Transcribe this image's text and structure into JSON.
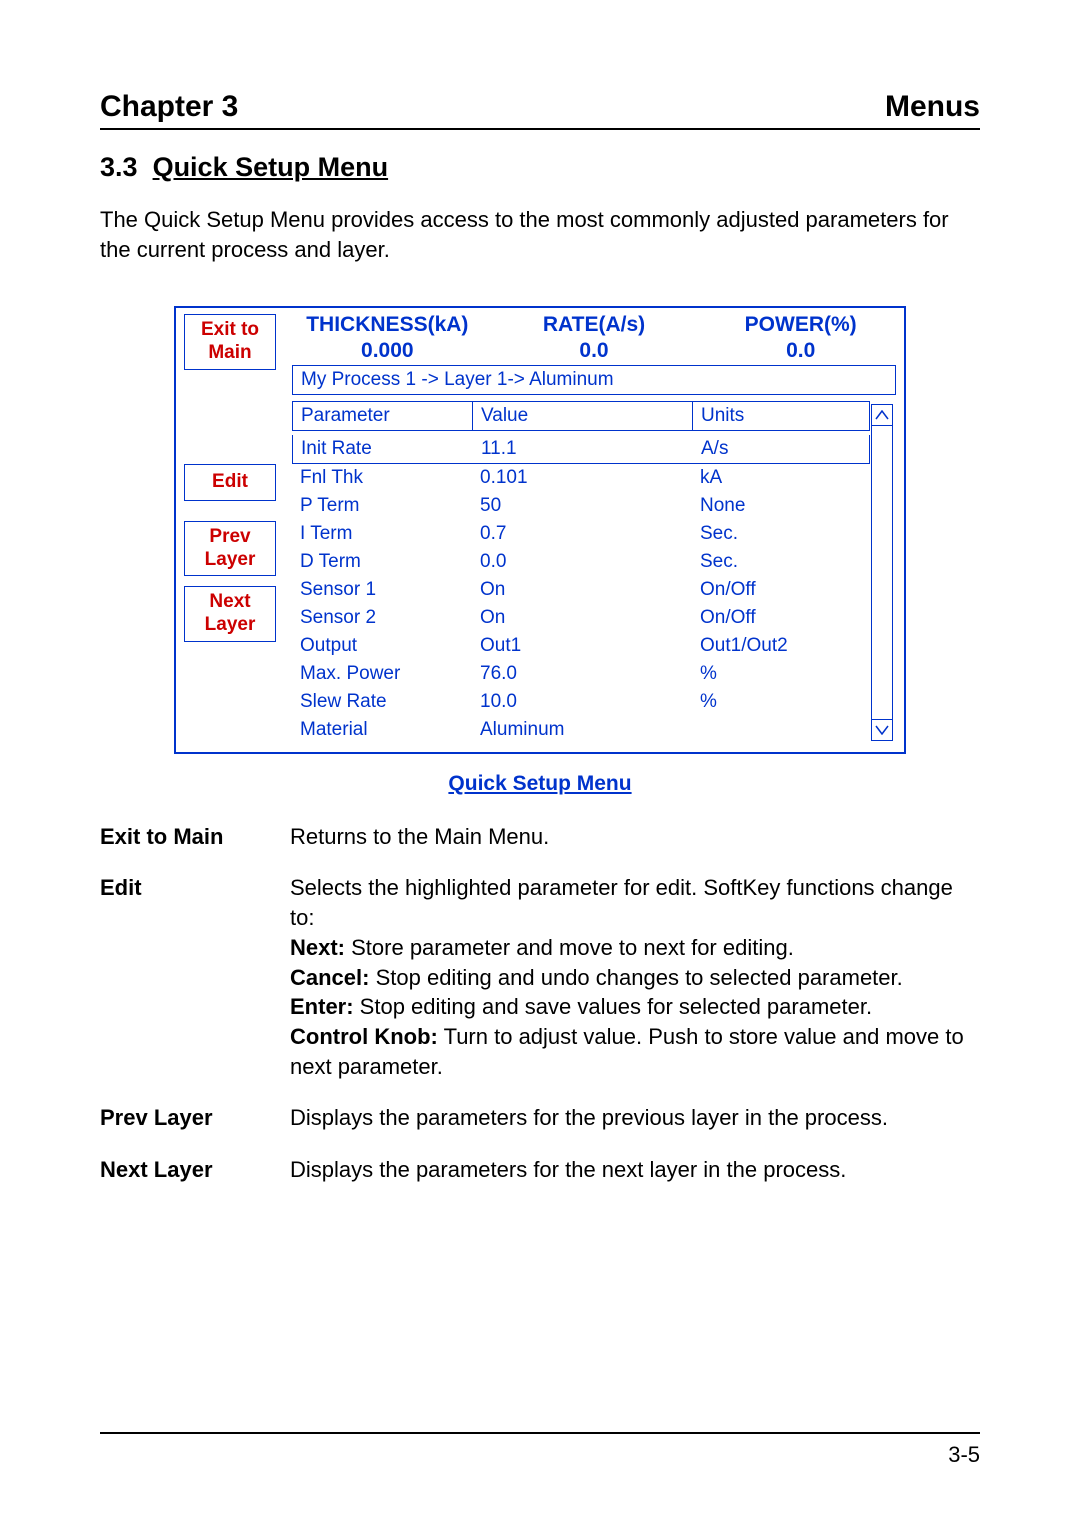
{
  "header": {
    "chapter": "Chapter 3",
    "title": "Menus"
  },
  "section": {
    "number": "3.3",
    "title": "Quick Setup Menu"
  },
  "intro": "The Quick Setup Menu provides access to the most commonly adjusted parameters for the current process and layer.",
  "softkeys": {
    "exit": "Exit to Main",
    "edit": "Edit",
    "prev": "Prev Layer",
    "next": "Next Layer"
  },
  "readouts": {
    "thickness_label": "THICKNESS(kA)",
    "thickness_value": "0.000",
    "rate_label": "RATE(A/s)",
    "rate_value": "0.0",
    "power_label": "POWER(%)",
    "power_value": "0.0"
  },
  "breadcrumb": "My Process 1 -> Layer 1-> Aluminum",
  "table": {
    "headers": {
      "param": "Parameter",
      "value": "Value",
      "units": "Units"
    },
    "rows": [
      {
        "p": "Init Rate",
        "v": "11.1",
        "u": "A/s"
      },
      {
        "p": "Fnl Thk",
        "v": "0.101",
        "u": "kA"
      },
      {
        "p": "P Term",
        "v": "50",
        "u": "None"
      },
      {
        "p": "I Term",
        "v": "0.7",
        "u": "Sec."
      },
      {
        "p": "D Term",
        "v": "0.0",
        "u": "Sec."
      },
      {
        "p": "Sensor 1",
        "v": "On",
        "u": "On/Off"
      },
      {
        "p": "Sensor 2",
        "v": "On",
        "u": "On/Off"
      },
      {
        "p": "Output",
        "v": "Out1",
        "u": "Out1/Out2"
      },
      {
        "p": "Max. Power",
        "v": "76.0",
        "u": "%"
      },
      {
        "p": "Slew Rate",
        "v": "10.0",
        "u": "%"
      },
      {
        "p": "Material",
        "v": "Aluminum",
        "u": ""
      }
    ]
  },
  "caption": "Quick Setup Menu",
  "desc": {
    "exit": {
      "term": "Exit to Main",
      "text": "Returns to the Main Menu."
    },
    "edit": {
      "term": "Edit",
      "lead": "Selects the highlighted parameter for edit.  SoftKey functions change to:",
      "next_label": "Next:",
      "next_text": " Store parameter and move to next for editing.",
      "cancel_label": "Cancel:",
      "cancel_text": " Stop editing and undo changes to selected parameter.",
      "enter_label": "Enter:",
      "enter_text": " Stop editing and save values for selected parameter.",
      "knob_label": "Control Knob:",
      "knob_text": " Turn to adjust value.  Push to store value and move to next parameter."
    },
    "prev": {
      "term": "Prev Layer",
      "text": "Displays the parameters for the previous layer in the process."
    },
    "nextlayer": {
      "term": "Next Layer",
      "text": "Displays the parameters for the next layer in the process."
    }
  },
  "page_number": "3-5"
}
